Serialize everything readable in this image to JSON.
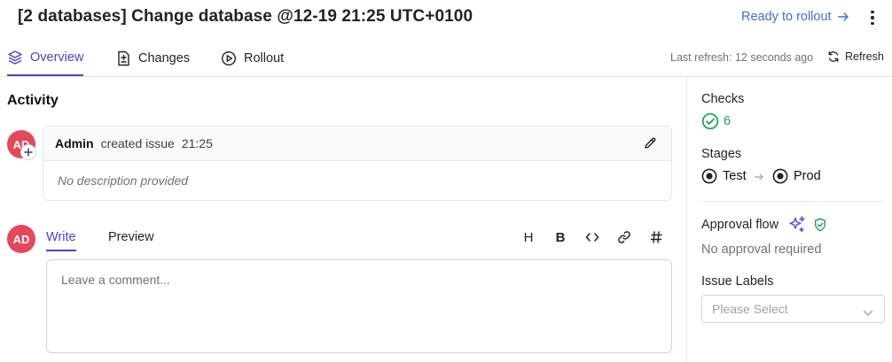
{
  "header": {
    "title": "[2 databases] Change database @12-19 21:25 UTC+0100",
    "ready_link": "Ready to rollout"
  },
  "tabs": [
    {
      "label": "Overview",
      "icon": "layers-icon",
      "active": true
    },
    {
      "label": "Changes",
      "icon": "file-diff-icon",
      "active": false
    },
    {
      "label": "Rollout",
      "icon": "play-circle-icon",
      "active": false
    }
  ],
  "refresh": {
    "last_refresh": "Last refresh: 12 seconds ago",
    "button_label": "Refresh"
  },
  "activity": {
    "title": "Activity",
    "avatar_initials": "AD",
    "event": {
      "author": "Admin",
      "action": "created issue",
      "time": "21:25",
      "body": "No description provided"
    }
  },
  "editor": {
    "avatar_initials": "AD",
    "tab_write": "Write",
    "tab_preview": "Preview",
    "tools": {
      "heading": "H",
      "bold": "B"
    },
    "placeholder": "Leave a comment..."
  },
  "sidebar": {
    "checks_label": "Checks",
    "checks_count": "6",
    "stages_label": "Stages",
    "stages": [
      "Test",
      "Prod"
    ],
    "approval_label": "Approval flow",
    "approval_status": "No approval required",
    "labels_label": "Issue Labels",
    "labels_placeholder": "Please Select"
  },
  "colors": {
    "accent": "#4b46c2",
    "link": "#3b6ed8",
    "success": "#16a34a",
    "avatar": "#e5475b"
  }
}
